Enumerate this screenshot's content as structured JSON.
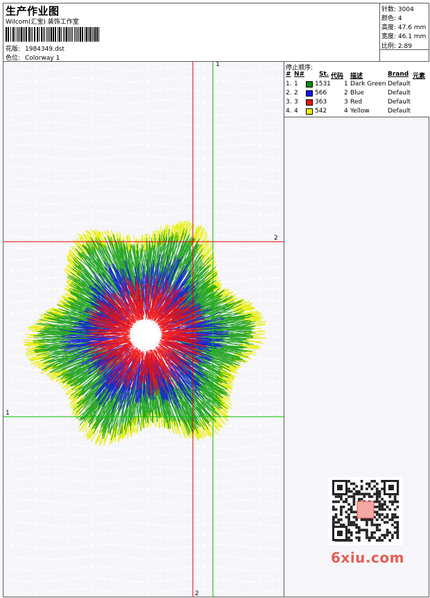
{
  "header": {
    "title": "生产作业图",
    "company": "Wilcom(汇宝) 装饰工作室",
    "design_label": "花版:",
    "design_file": "1984349.dst",
    "colorway_label": "色位:",
    "colorway": "Colorway 1"
  },
  "stats": {
    "stitches": "针数: 3004",
    "colors": "颜色: 4",
    "height": "高度: 47.6 mm",
    "width": "宽度: 46.1 mm",
    "scale": "比例: 2.89"
  },
  "stop_sequence": {
    "title": "停止顺序:",
    "headers": {
      "num": "#",
      "needle": "N#",
      "stitches": "St.",
      "code": "代码",
      "description": "描述",
      "brand": "Brand",
      "element": "元素"
    },
    "rows": [
      {
        "num": "1.",
        "needle": "1",
        "color": "#0a8a0a",
        "stitches": "1531",
        "code": "1",
        "description": "Dark Green",
        "brand": "Default"
      },
      {
        "num": "2.",
        "needle": "2",
        "color": "#1010e0",
        "stitches": "566",
        "code": "2",
        "description": "Blue",
        "brand": "Default"
      },
      {
        "num": "3.",
        "needle": "3",
        "color": "#ee1010",
        "stitches": "363",
        "code": "3",
        "description": "Red",
        "brand": "Default"
      },
      {
        "num": "4.",
        "needle": "4",
        "color": "#f0f000",
        "stitches": "542",
        "code": "4",
        "description": "Yellow",
        "brand": "Default"
      }
    ]
  },
  "guides": {
    "top_label": "1",
    "right_label": "2",
    "left_label": "1",
    "bottom_label": "2",
    "vertical_green": "#00c000",
    "vertical_red": "#e00000"
  },
  "watermark": {
    "text": "6xiu.com",
    "badge": "设计图"
  }
}
